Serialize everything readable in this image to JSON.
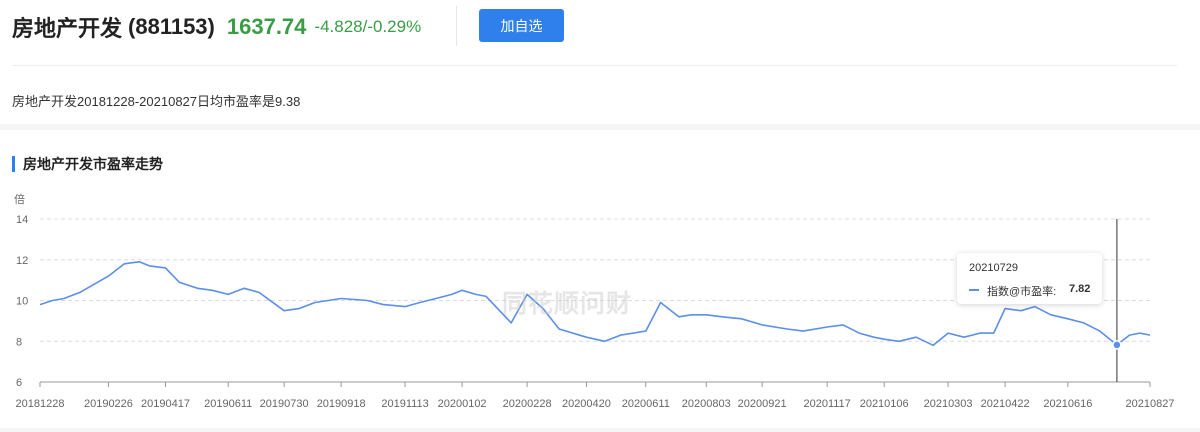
{
  "header": {
    "name": "房地产开发",
    "code": "(881153)",
    "price": "1637.74",
    "change": "-4.828/-0.29%",
    "price_color": "#3a9d46",
    "add_button": "加自选"
  },
  "summary": "房地产开发20181228-20210827日均市盈率是9.38",
  "section_title": "房地产开发市盈率走势",
  "watermark": "同花顺问财",
  "tooltip": {
    "date": "20210729",
    "label": "指数@市盈率:",
    "value": "7.82"
  },
  "colors": {
    "accent": "#2f80ed",
    "line": "#5b8fe8"
  },
  "chart_data": {
    "type": "line",
    "title": "",
    "xlabel": "",
    "ylabel": "倍",
    "ylim": [
      6,
      14
    ],
    "yticks": [
      6,
      8,
      10,
      12,
      14
    ],
    "grid": true,
    "x_tick_labels": [
      "20181228",
      "20190226",
      "20190417",
      "20190611",
      "20190730",
      "20190918",
      "20191113",
      "20200102",
      "20200228",
      "20200420",
      "20200611",
      "20200803",
      "20200921",
      "20201117",
      "20210106",
      "20210303",
      "20210422",
      "20210616",
      "20210827"
    ],
    "x": [
      "20181228",
      "20190108",
      "20190118",
      "20190201",
      "20190226",
      "20190312",
      "20190325",
      "20190403",
      "20190417",
      "20190429",
      "20190515",
      "20190528",
      "20190611",
      "20190625",
      "20190708",
      "20190730",
      "20190812",
      "20190826",
      "20190918",
      "20191011",
      "20191025",
      "20191113",
      "20191126",
      "20191210",
      "20191224",
      "20200102",
      "20200114",
      "20200123",
      "20200214",
      "20200228",
      "20200313",
      "20200327",
      "20200420",
      "20200506",
      "20200520",
      "20200611",
      "20200624",
      "20200710",
      "20200721",
      "20200803",
      "20200817",
      "20200903",
      "20200921",
      "20201013",
      "20201027",
      "20201117",
      "20201201",
      "20201215",
      "20201228",
      "20210106",
      "20210119",
      "20210203",
      "20210218",
      "20210303",
      "20210317",
      "20210331",
      "20210412",
      "20210422",
      "20210506",
      "20210518",
      "20210601",
      "20210616",
      "20210630",
      "20210714",
      "20210729",
      "20210809",
      "20210818",
      "20210827"
    ],
    "series": [
      {
        "name": "指数@市盈率",
        "values": [
          9.8,
          10.0,
          10.1,
          10.4,
          11.2,
          11.8,
          11.9,
          11.7,
          11.6,
          10.9,
          10.6,
          10.5,
          10.3,
          10.6,
          10.4,
          9.5,
          9.6,
          9.9,
          10.1,
          10.0,
          9.8,
          9.7,
          9.9,
          10.1,
          10.3,
          10.5,
          10.3,
          10.2,
          8.9,
          10.3,
          9.6,
          8.6,
          8.2,
          8.0,
          8.3,
          8.5,
          9.9,
          9.2,
          9.3,
          9.3,
          9.2,
          9.1,
          8.8,
          8.6,
          8.5,
          8.7,
          8.8,
          8.4,
          8.2,
          8.1,
          8.0,
          8.2,
          7.8,
          8.4,
          8.2,
          8.4,
          8.4,
          9.6,
          9.5,
          9.7,
          9.3,
          9.1,
          8.9,
          8.5,
          7.82,
          8.3,
          8.4,
          8.3
        ]
      }
    ]
  }
}
